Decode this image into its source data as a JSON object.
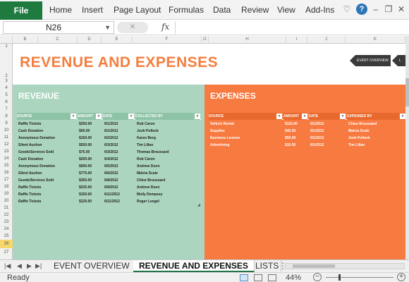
{
  "ribbon": {
    "file_label": "File",
    "tabs": [
      "Home",
      "Insert",
      "Page Layout",
      "Formulas",
      "Data",
      "Review",
      "View",
      "Add-Ins"
    ]
  },
  "formula_bar": {
    "name_box": "N26",
    "fx_label": "fx",
    "cancel_symbol": "✕"
  },
  "columns": [
    "B",
    "C",
    "D",
    "E",
    "F",
    "G",
    "H",
    "I",
    "J",
    "K"
  ],
  "rows": [
    "1",
    "2",
    "3",
    "4",
    "5",
    "6",
    "7",
    "8",
    "9",
    "10",
    "11",
    "12",
    "13",
    "14",
    "15",
    "16",
    "17",
    "18",
    "19",
    "20",
    "21",
    "22",
    "23",
    "24",
    "25",
    "26",
    "27"
  ],
  "page": {
    "title": "REVENUE AND EXPENSES",
    "nav_tabs": [
      "EVENT OVERVIEW",
      "L"
    ]
  },
  "revenue": {
    "title": "REVENUE",
    "headers": [
      "SOURCE",
      "AMOUNT",
      "DATE",
      "COLLECTED BY"
    ],
    "rows": [
      [
        "Raffle Tickets",
        "$250.00",
        "6/1/2012",
        "Rob Caron"
      ],
      [
        "Cash Donation",
        "$50.00",
        "6/1/2012",
        "Josh Pollock"
      ],
      [
        "Anonymous Donation",
        "$150.00",
        "6/2/2012",
        "Karen Berg"
      ],
      [
        "Silent Auction",
        "$550.00",
        "6/3/2012",
        "Tim Lillan"
      ],
      [
        "Goods/Services Sold",
        "$75.00",
        "6/3/2012",
        "Thomas Broussard"
      ],
      [
        "Cash Donation",
        "$200.00",
        "6/4/2012",
        "Rob Caron"
      ],
      [
        "Anonymous Donation",
        "$500.00",
        "6/5/2012",
        "Andrew Dunn"
      ],
      [
        "Silent Auction",
        "$775.00",
        "6/6/2012",
        "Malcia Scale"
      ],
      [
        "Goods/Services Sold",
        "$350.00",
        "6/8/2012",
        "Chloe Broussard"
      ],
      [
        "Raffle Tickets",
        "$225.00",
        "6/9/2012",
        "Andrew Dunn"
      ],
      [
        "Raffle Tickets",
        "$150.00",
        "6/11/2012",
        "Molly Dempsey"
      ],
      [
        "Raffle Tickets",
        "$125.00",
        "6/11/2012",
        "Roger Lengel"
      ]
    ]
  },
  "expenses": {
    "title": "EXPENSES",
    "headers": [
      "SOURCE",
      "AMOUNT",
      "DATE",
      "EXPENSED BY"
    ],
    "rows": [
      [
        "Vehicle Rental",
        "$115.00",
        "6/1/2012",
        "Chloe Broussard"
      ],
      [
        "Supplies",
        "$45.50",
        "6/1/2012",
        "Malcia Scale"
      ],
      [
        "Business License",
        "$50.00",
        "6/1/2012",
        "Josh Pollock"
      ],
      [
        "Advertising",
        "$15.50",
        "6/1/2012",
        "Tim Lillan"
      ]
    ]
  },
  "sheet_tabs": [
    "EVENT OVERVIEW",
    "REVENUE AND EXPENSES",
    "LISTS"
  ],
  "status": {
    "ready": "Ready",
    "zoom": "44%",
    "zoom_level": 0.44
  },
  "colors": {
    "file_green": "#1f7a3f",
    "title_orange": "#f47e3e",
    "revenue_panel": "#abd5bf",
    "expenses_panel": "#f77a40",
    "nav_tab_dark": "#3a3a3a"
  }
}
